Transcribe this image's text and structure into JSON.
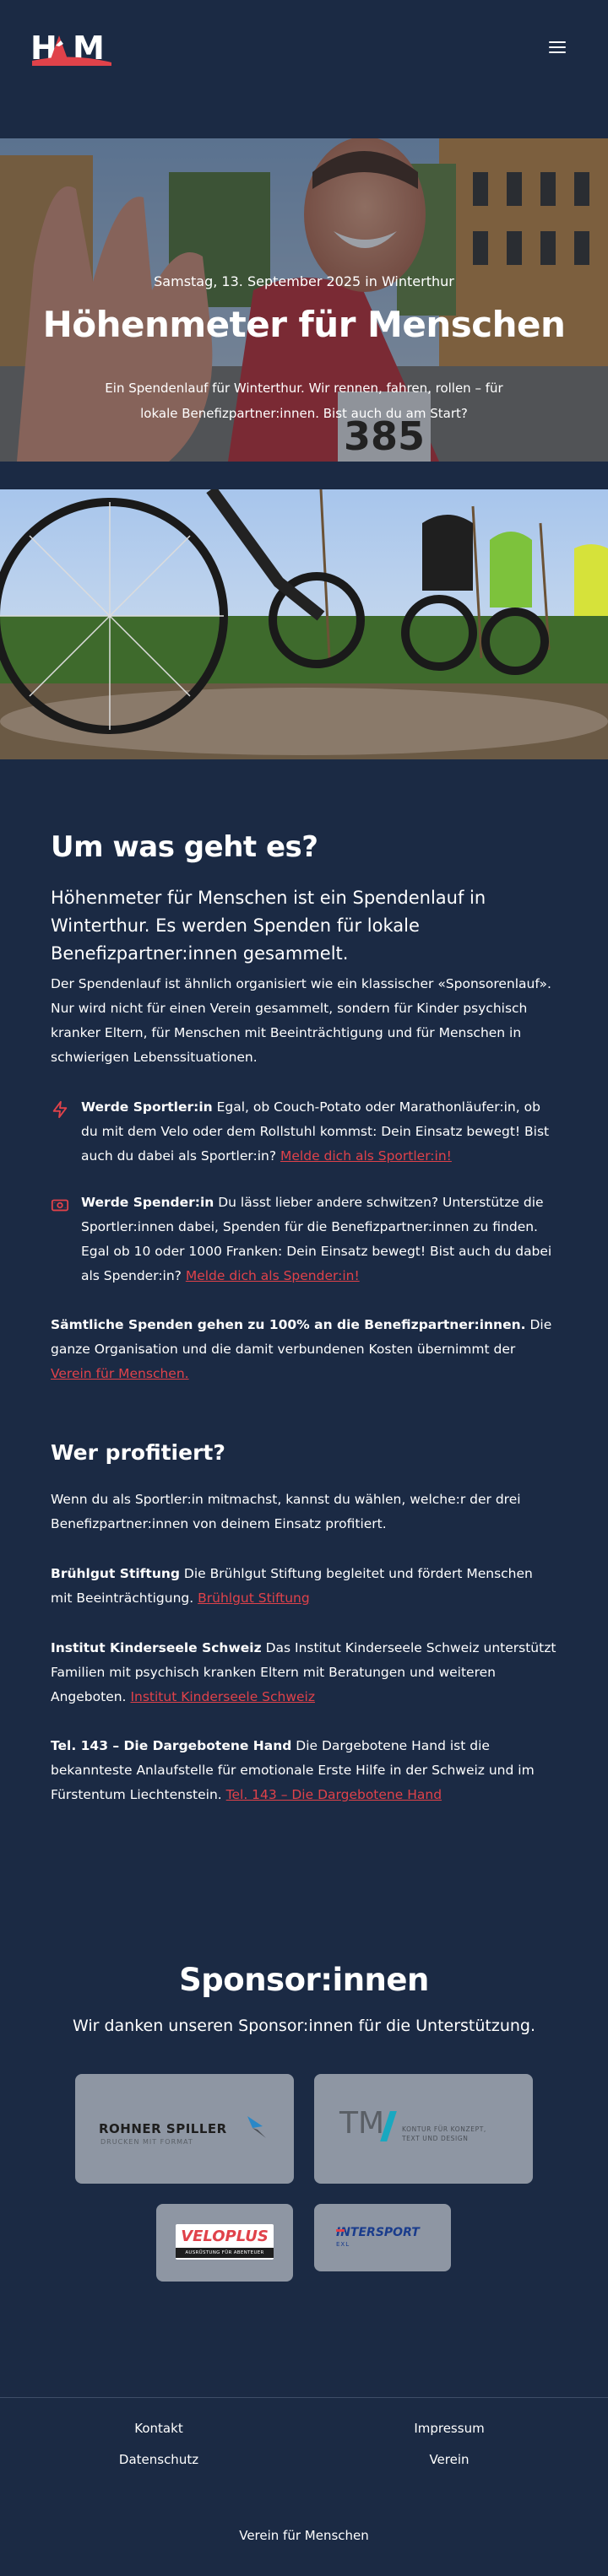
{
  "header": {
    "logo_alt": "HfM",
    "menu_icon": "hamburger-icon"
  },
  "hero": {
    "date": "Samstag, 13. September 2025 in Winterthur",
    "title": "Höhenmeter für Menschen",
    "text": "Ein Spendenlauf für Winterthur. Wir rennen, fahren, rollen – für lokale Benefizpartner:innen. Bist auch du am Start?",
    "bib_number": "385"
  },
  "about": {
    "heading": "Um was geht es?",
    "lead": "Höhenmeter für Menschen ist ein Spendenlauf in Winterthur. Es werden Spenden für lokale Benefizpartner:innen gesammelt.",
    "intro": "Der Spendenlauf ist ähnlich organisiert wie ein klassischer «Sponsorenlauf». Nur wird nicht für einen Verein gesammelt, sondern für Kinder psychisch kranker Eltern, für Menschen mit Beeinträchtigung und für Menschen in schwierigen Lebenssituationen.",
    "sportler": {
      "icon": "lightning-icon",
      "title": "Werde Sportler:in",
      "text": "Egal, ob Couch-Potato oder Marathonläufer:in, ob du mit dem Velo oder dem Rollstuhl kommst: Dein Einsatz bewegt! Bist auch du dabei als Sportler:in?",
      "link": "Melde dich als Sportler:in!"
    },
    "spender": {
      "icon": "money-icon",
      "title": "Werde Spender:in",
      "text": "Du lässt lieber andere schwitzen? Unterstütze die Sportler:innen dabei, Spenden für die Benefizpartner:innen zu finden. Egal ob 10 oder 1000 Franken: Dein Einsatz bewegt! Bist auch du dabei als Spender:in?",
      "link": "Melde dich als Spender:in!"
    },
    "donations": {
      "bold": "Sämtliche Spenden gehen zu 100% an die Benefizpartner:innen.",
      "text": "Die ganze Organisation und die damit verbundenen Kosten übernimmt der",
      "link": "Verein für Menschen."
    }
  },
  "profit": {
    "heading": "Wer profitiert?",
    "intro": "Wenn du als Sportler:in mitmachst, kannst du wählen, welche:r der drei Benefizpartner:innen von deinem Einsatz profitiert.",
    "partners": [
      {
        "name": "Brühlgut Stiftung",
        "text": "Die Brühlgut Stiftung begleitet und fördert Menschen mit Beeinträchtigung.",
        "link": "Brühlgut Stiftung"
      },
      {
        "name": "Institut Kinderseele Schweiz",
        "text": "Das Institut Kinderseele Schweiz unterstützt Familien mit psychisch kranken Eltern mit Beratungen und weiteren Angeboten.",
        "link": "Institut Kinderseele Schweiz"
      },
      {
        "name": "Tel. 143 – Die Dargebotene Hand",
        "text": "Die Dargebotene Hand ist die bekannteste Anlaufstelle für emotionale Erste Hilfe in der Schweiz und im Fürstentum Liechtenstein.",
        "link": "Tel. 143 – Die Dargebotene Hand"
      }
    ]
  },
  "sponsors": {
    "heading": "Sponsor:innen",
    "subtitle": "Wir danken unseren Sponsor:innen für die Unterstützung.",
    "items": [
      {
        "name": "ROHNER SPILLER",
        "tagline": "DRUCKEN MIT FORMAT"
      },
      {
        "name": "TM",
        "tagline": "KONTUR FÜR KONZEPT, TEXT UND DESIGN"
      },
      {
        "name": "VELOPLUS",
        "tagline": "AUSRÜSTUNG FÜR ABENTEUER"
      },
      {
        "name": "INTERSPORT",
        "tagline": "EXL"
      }
    ]
  },
  "footer": {
    "links": [
      "Kontakt",
      "Impressum",
      "Datenschutz",
      "Verein"
    ],
    "org": "Verein für Menschen"
  },
  "colors": {
    "background": "#1b2a44",
    "accent": "#e0424a",
    "card": "#8e96a3"
  }
}
